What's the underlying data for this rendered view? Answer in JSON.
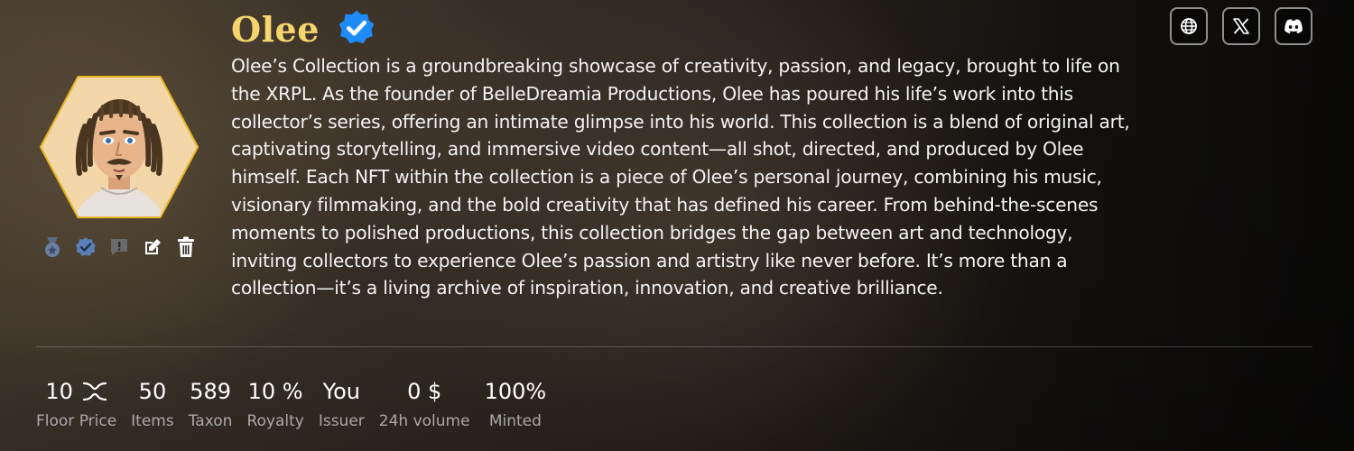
{
  "collection": {
    "name": "Olee",
    "description": "Olee’s Collection is a groundbreaking showcase of creativity, passion, and legacy, brought to life on the XRPL. As the founder of BelleDreamia Productions, Olee has poured his life’s work into this collector’s series, offering an intimate glimpse into his world. This collection is a blend of original art, captivating storytelling, and immersive video content—all shot, directed, and produced by Olee himself. Each NFT within the collection is a piece of Olee’s personal journey, combining his music, visionary filmmaking, and the bold creativity that has defined his career. From behind-the-scenes moments to polished productions, this collection bridges the gap between art and technology, inviting collectors to experience Olee’s passion and artistry like never before. It’s more than a collection—it’s a living archive of inspiration, innovation, and creative brilliance."
  },
  "icons": {
    "verified": "verified-badge-icon",
    "medal": "medal-icon",
    "verify": "verify-check-icon",
    "report": "report-icon",
    "edit": "edit-icon",
    "delete": "trash-icon",
    "website": "globe-icon",
    "x": "x-logo-icon",
    "discord": "discord-icon",
    "currency": "xrp-icon"
  },
  "stats": [
    {
      "value": "10",
      "label": "Floor Price"
    },
    {
      "value": "50",
      "label": "Items"
    },
    {
      "value": "589",
      "label": "Taxon"
    },
    {
      "value": "10 %",
      "label": "Royalty"
    },
    {
      "value": "You",
      "label": "Issuer"
    },
    {
      "value": "0 $",
      "label": "24h volume"
    },
    {
      "value": "100%",
      "label": "Minted"
    }
  ],
  "colors": {
    "title": "#f6d46e",
    "verified": "#1d8cf8",
    "avatar_border": "#e6b422"
  }
}
